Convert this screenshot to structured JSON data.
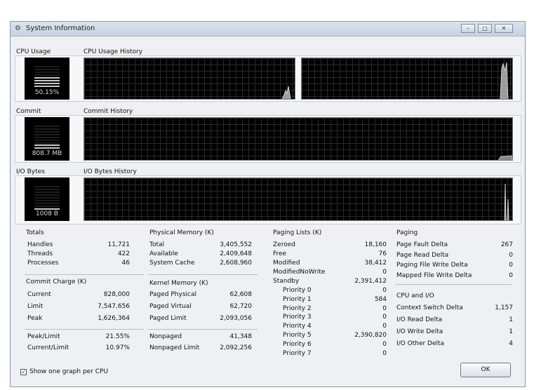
{
  "window": {
    "title": "System Information"
  },
  "cpu": {
    "label": "CPU Usage",
    "history_label": "CPU Usage History",
    "value": "50.15%",
    "fraction": 0.5
  },
  "commit": {
    "label": "Commit",
    "history_label": "Commit History",
    "value": "808.7 MB",
    "fraction": 0.2
  },
  "io": {
    "label": "I/O Bytes",
    "history_label": "I/O Bytes History",
    "value": "1008 B",
    "fraction": 0.05
  },
  "totals": {
    "title": "Totals",
    "rows": [
      {
        "label": "Handles",
        "value": "11,721"
      },
      {
        "label": "Threads",
        "value": "422"
      },
      {
        "label": "Processes",
        "value": "46"
      }
    ]
  },
  "commit_charge": {
    "title": "Commit Charge (K)",
    "rows": [
      {
        "label": "Current",
        "value": "828,000"
      },
      {
        "label": "Limit",
        "value": "7,547,656"
      },
      {
        "label": "Peak",
        "value": "1,626,364"
      }
    ],
    "ratio_rows": [
      {
        "label": "Peak/Limit",
        "value": "21.55%"
      },
      {
        "label": "Current/Limit",
        "value": "10.97%"
      }
    ]
  },
  "physical_memory": {
    "title": "Physical Memory (K)",
    "rows": [
      {
        "label": "Total",
        "value": "3,405,552"
      },
      {
        "label": "Available",
        "value": "2,409,648"
      },
      {
        "label": "System Cache",
        "value": "2,608,960"
      }
    ]
  },
  "kernel_memory": {
    "title": "Kernel Memory (K)",
    "rows": [
      {
        "label": "Paged Physical",
        "value": "62,608"
      },
      {
        "label": "Paged Virtual",
        "value": "62,720"
      },
      {
        "label": "Paged Limit",
        "value": "2,093,056"
      }
    ],
    "nonpaged_rows": [
      {
        "label": "Nonpaged",
        "value": "41,348"
      },
      {
        "label": "Nonpaged Limit",
        "value": "2,092,256"
      }
    ]
  },
  "paging_lists": {
    "title": "Paging Lists (K)",
    "rows": [
      {
        "label": "Zeroed",
        "value": "18,160"
      },
      {
        "label": "Free",
        "value": "76"
      },
      {
        "label": "Modified",
        "value": "38,412"
      },
      {
        "label": "ModifiedNoWrite",
        "value": "0"
      },
      {
        "label": "Standby",
        "value": "2,391,412"
      }
    ],
    "priority_rows": [
      {
        "label": "Priority 0",
        "value": "0"
      },
      {
        "label": "Priority 1",
        "value": "584"
      },
      {
        "label": "Priority 2",
        "value": "0"
      },
      {
        "label": "Priority 3",
        "value": "0"
      },
      {
        "label": "Priority 4",
        "value": "0"
      },
      {
        "label": "Priority 5",
        "value": "2,390,820"
      },
      {
        "label": "Priority 6",
        "value": "0"
      },
      {
        "label": "Priority 7",
        "value": "0"
      }
    ]
  },
  "paging": {
    "title": "Paging",
    "rows": [
      {
        "label": "Page Fault Delta",
        "value": "267"
      },
      {
        "label": "Page Read Delta",
        "value": "0"
      },
      {
        "label": "Paging File Write Delta",
        "value": "0"
      },
      {
        "label": "Mapped File Write Delta",
        "value": "0"
      }
    ]
  },
  "cpu_io": {
    "title": "CPU and I/O",
    "rows": [
      {
        "label": "Context Switch Delta",
        "value": "1,157"
      },
      {
        "label": "I/O Read Delta",
        "value": "1"
      },
      {
        "label": "I/O Write Delta",
        "value": "1"
      },
      {
        "label": "I/O Other Delta",
        "value": "4"
      }
    ]
  },
  "footer": {
    "checkbox_label": "Show one graph per CPU",
    "checkbox_checked": true,
    "ok_label": "OK"
  }
}
